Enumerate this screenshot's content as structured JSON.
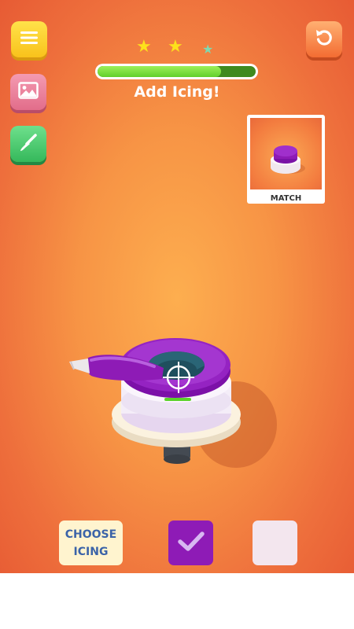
{
  "hud": {
    "stars_filled": 2,
    "stars_total": 3,
    "progress": 0.78,
    "instruction": "Add Icing!"
  },
  "icons": {
    "menu": "menu-icon",
    "gallery": "image-icon",
    "tool": "spatula-icon",
    "restart": "restart-icon"
  },
  "match_card": {
    "label": "MATCH"
  },
  "bottom_bar": {
    "choose_icing_line1": "CHOOSE",
    "choose_icing_line2": "ICING",
    "colors": [
      "#8e1bb6",
      "#f3e6ee"
    ],
    "selected_color_index": 0
  },
  "colors": {
    "background_center": "#fdae4f",
    "background_edge": "#e75b34",
    "icing_purple": "#8e1bb6",
    "progress_green": "#6ed42f",
    "star_yellow": "#fde11b",
    "star_teal": "#7ed9b0"
  }
}
